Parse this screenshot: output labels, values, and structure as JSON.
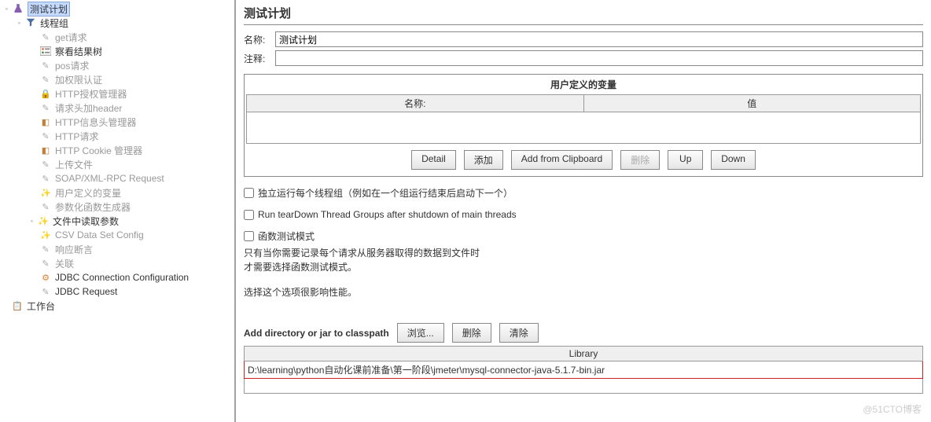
{
  "tree": {
    "root": {
      "label": "测试计划",
      "selected": true
    },
    "thread_group": {
      "label": "线程组"
    },
    "items": [
      {
        "label": "get请求",
        "icon": "pencil",
        "gray": true
      },
      {
        "label": "察看结果树",
        "icon": "tree",
        "gray": false
      },
      {
        "label": "pos请求",
        "icon": "pencil",
        "gray": true
      },
      {
        "label": "加权限认证",
        "icon": "pencil",
        "gray": true
      },
      {
        "label": "HTTP授权管理器",
        "icon": "lock",
        "gray": true
      },
      {
        "label": "请求头加header",
        "icon": "pencil",
        "gray": true
      },
      {
        "label": "HTTP信息头管理器",
        "icon": "cookie",
        "gray": true
      },
      {
        "label": "HTTP请求",
        "icon": "pencil",
        "gray": true
      },
      {
        "label": "HTTP Cookie 管理器",
        "icon": "cookie",
        "gray": true
      },
      {
        "label": "上传文件",
        "icon": "pencil",
        "gray": true
      },
      {
        "label": "SOAP/XML-RPC Request",
        "icon": "pencil",
        "gray": true
      },
      {
        "label": "用户定义的变量",
        "icon": "wand",
        "gray": true
      },
      {
        "label": "参数化函数生成器",
        "icon": "pencil",
        "gray": true
      },
      {
        "label": "文件中读取参数",
        "icon": "wand",
        "gray": false
      },
      {
        "label": "CSV Data Set Config",
        "icon": "wand",
        "gray": true
      },
      {
        "label": "响应断言",
        "icon": "pencil",
        "gray": true
      },
      {
        "label": "关联",
        "icon": "pencil",
        "gray": true
      },
      {
        "label": "JDBC Connection Configuration",
        "icon": "jdbc",
        "gray": false
      },
      {
        "label": "JDBC Request",
        "icon": "pencil",
        "gray": false
      }
    ],
    "workbench": {
      "label": "工作台"
    }
  },
  "panel": {
    "title": "测试计划",
    "name_label": "名称:",
    "name_value": "测试计划",
    "comment_label": "注释:",
    "comment_value": ""
  },
  "vars": {
    "section_title": "用户定义的变量",
    "col_name": "名称:",
    "col_value": "值",
    "buttons": {
      "detail": "Detail",
      "add": "添加",
      "add_clipboard": "Add from Clipboard",
      "delete": "删除",
      "up": "Up",
      "down": "Down"
    }
  },
  "checkboxes": {
    "serialize": "独立运行每个线程组（例如在一个组运行结束后启动下一个）",
    "teardown": "Run tearDown Thread Groups after shutdown of main threads",
    "functional": "函数测试模式"
  },
  "info": {
    "line1": "只有当你需要记录每个请求从服务器取得的数据到文件时",
    "line2": "才需要选择函数测试模式。",
    "line3": "选择这个选项很影响性能。"
  },
  "classpath": {
    "label": "Add directory or jar to classpath",
    "browse": "浏览...",
    "delete": "删除",
    "clear": "清除",
    "lib_header": "Library",
    "lib_path": "D:\\learning\\python自动化课前准备\\第一阶段\\jmeter\\mysql-connector-java-5.1.7-bin.jar"
  },
  "watermark": "@51CTO博客"
}
